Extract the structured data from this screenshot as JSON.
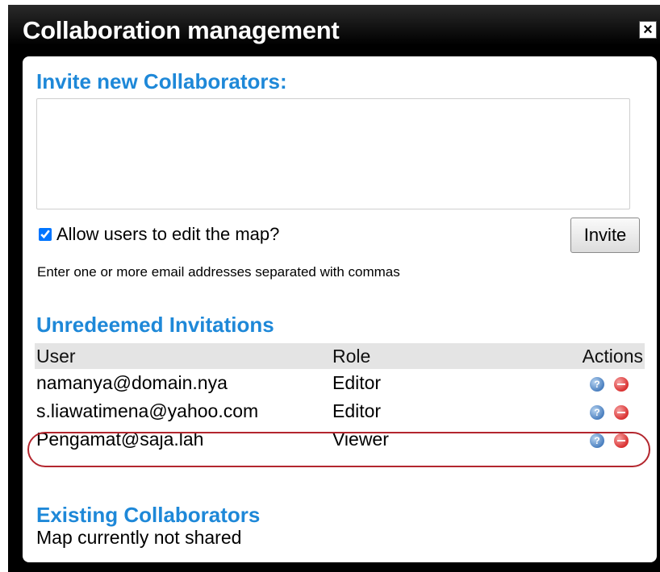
{
  "dialog": {
    "title": "Collaboration management",
    "close_label": "×"
  },
  "invite": {
    "heading": "Invite new Collaborators:",
    "emails_value": "",
    "allow_edit_label": "Allow users to edit the map?",
    "allow_edit_checked": true,
    "invite_button_label": "Invite",
    "hint": "Enter one or more email addresses separated with commas"
  },
  "unredeemed": {
    "heading": "Unredeemed Invitations",
    "columns": {
      "user": "User",
      "role": "Role",
      "actions": "Actions"
    },
    "rows": [
      {
        "user": "namanya@domain.nya",
        "role": "Editor",
        "highlighted": false
      },
      {
        "user": "s.liawatimena@yahoo.com",
        "role": "Editor",
        "highlighted": false
      },
      {
        "user": "Pengamat@saja.lah",
        "role": "Viewer",
        "highlighted": true
      }
    ],
    "row_icons": [
      "help-icon",
      "remove-icon"
    ],
    "highlight_color": "#b3262e"
  },
  "existing": {
    "heading": "Existing Collaborators",
    "status": "Map currently not shared"
  },
  "colors": {
    "heading_blue": "#1e88d8",
    "title_bar": "#000000",
    "table_header_bg": "#e4e4e4"
  }
}
